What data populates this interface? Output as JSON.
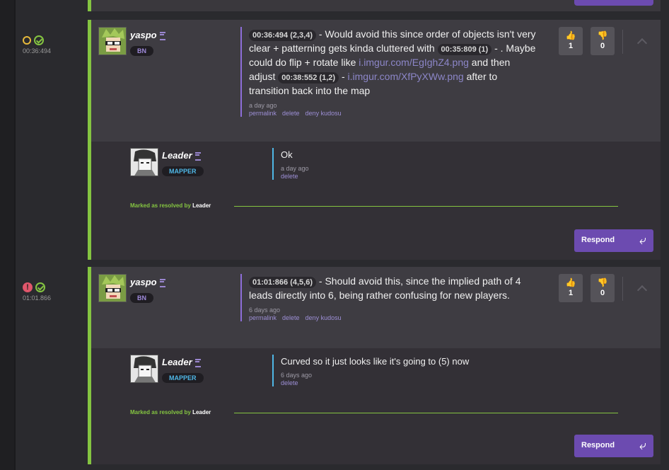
{
  "discussions": [
    {
      "timeline": {
        "time": "00:36:494",
        "state": "open-resolved"
      },
      "author": {
        "name": "yaspo",
        "badge": "BN"
      },
      "message": {
        "ts1": "00:36:494 (2,3,4)",
        "text1": " - Would avoid this since order of objects isn't very clear + patterning gets kinda cluttered with ",
        "ts2": "00:35:809 (1)",
        "text2": " - . Maybe could do flip + rotate like ",
        "link1": "i.imgur.com/EgIghZ4.png",
        "text3": " and then adjust ",
        "ts3": "00:38:552 (1,2)",
        "text4": " - ",
        "link2": "i.imgur.com/XfPyXWw.png",
        "text5": " after to transition back into the map"
      },
      "ago": "a day ago",
      "actions": {
        "permalink": "permalink",
        "delete": "delete",
        "deny": "deny kudosu"
      },
      "votes": {
        "up": "1",
        "down": "0"
      },
      "reply": {
        "author": {
          "name": "Leader",
          "badge": "MAPPER"
        },
        "text": "Ok",
        "ago": "a day ago",
        "delete": "delete"
      },
      "resolved": {
        "prefix": "Marked as resolved by",
        "by": "Leader"
      },
      "respond": "Respond"
    },
    {
      "timeline": {
        "time": "01:01.866",
        "state": "alert-resolved"
      },
      "author": {
        "name": "yaspo",
        "badge": "BN"
      },
      "message": {
        "ts1": "01:01:866 (4,5,6)",
        "text1": " - Should avoid this, since the implied path of 4 leads directly into 6, being rather confusing for new players."
      },
      "ago": "6 days ago",
      "actions": {
        "permalink": "permalink",
        "delete": "delete",
        "deny": "deny kudosu"
      },
      "votes": {
        "up": "1",
        "down": "0"
      },
      "reply": {
        "author": {
          "name": "Leader",
          "badge": "MAPPER"
        },
        "text": "Curved so it just looks like it's going to (5) now",
        "ago": "6 days ago",
        "delete": "delete"
      },
      "resolved": {
        "prefix": "Marked as resolved by",
        "by": "Leader"
      },
      "respond": "Respond"
    }
  ],
  "icons": {
    "thumbs_up": "thumbs-up-icon",
    "thumbs_down": "thumbs-down-icon",
    "reply": "reply-arrow-icon",
    "collapse": "chevron-up-icon"
  },
  "colors": {
    "resolved": "#84c441",
    "accent": "#6c4bb0",
    "bn": "#a08bdc",
    "mapper": "#4fb7e6",
    "problem": "#e0566b",
    "pending": "#e6b93b"
  }
}
